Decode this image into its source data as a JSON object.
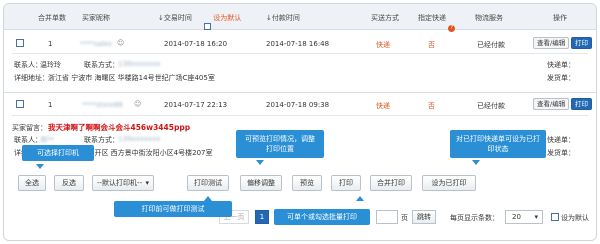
{
  "header": {
    "merge_count": "合并单数",
    "buyer_nick": "买家昵称",
    "trade_time": "交易时间",
    "set_default": "设为默认",
    "pay_time": "付款时间",
    "shipping_method": "买送方式",
    "designated_express": "指定快递",
    "logistics_service": "物流服务",
    "operation": "操作"
  },
  "orders": [
    {
      "merge": "1",
      "nick": "****sales",
      "trade_time": "2014-07-18 16:20",
      "pay_time": "2014-07-18 16:48",
      "method": "快递",
      "designated": "否",
      "logistics": "已经付款",
      "view_edit": "查看/编辑",
      "print": "打印",
      "contact_label": "联系人：",
      "contact_name": "温玲玲",
      "phone_label": "联系方式：",
      "phone": "138xxxxxxx",
      "address_label": "详细地址：",
      "address": "浙江省 宁波市 海曙区 华楼路14号世纪广场C座405室",
      "express_label": "快递单：",
      "delivery_label": "发货单："
    },
    {
      "merge": "1",
      "nick": "****store88",
      "trade_time": "2014-07-17 22:13",
      "pay_time": "2014-07-18 09:38",
      "method": "快递",
      "designated": "否",
      "logistics": "已经付款",
      "view_edit": "查看/编辑",
      "print": "打印",
      "buyer_msg_label": "买家留言：",
      "buyer_msg": "我天津啊了啊啊会斗会斗456w3445ppp",
      "contact_label": "联系人：",
      "contact_name": "郑**",
      "phone_label": "联系方式：",
      "phone": "139xxxxxxx",
      "address_label": "详细地址：",
      "address": "天津 天津市 南开区 西方景中街汝阳小区4号楼207室",
      "express_label": "快递单：",
      "delivery_label": "发货单："
    }
  ],
  "toolbar": {
    "select_all": "全选",
    "invert": "反选",
    "printer_default": "--默认打印机--",
    "print_test": "打印测试",
    "offset_adjust": "偏移调整",
    "preview": "预览",
    "print": "打印",
    "merge_print": "合并打印",
    "set_printed": "设为已打印"
  },
  "tips": {
    "select_printer": "可选择打印机",
    "preview_tip": "可预览打印情况，调整打印位置",
    "set_printed_tip": "对已打印快递单可设为已打印状态",
    "print_test_tip": "打印前可做打印测试",
    "batch_print_tip": "可单个或勾选批量打印"
  },
  "pager": {
    "prev": "上一页",
    "current_page": "1",
    "page_unit": "页",
    "jump": "跳转",
    "per_page_label": "每页显示条数：",
    "per_page_value": "20",
    "set_default": "设为默认"
  },
  "colors": {
    "accent_blue": "#2468b4",
    "tip_blue": "#2b8fd6",
    "highlight_orange": "#e0541c",
    "message_red": "#d31515"
  }
}
